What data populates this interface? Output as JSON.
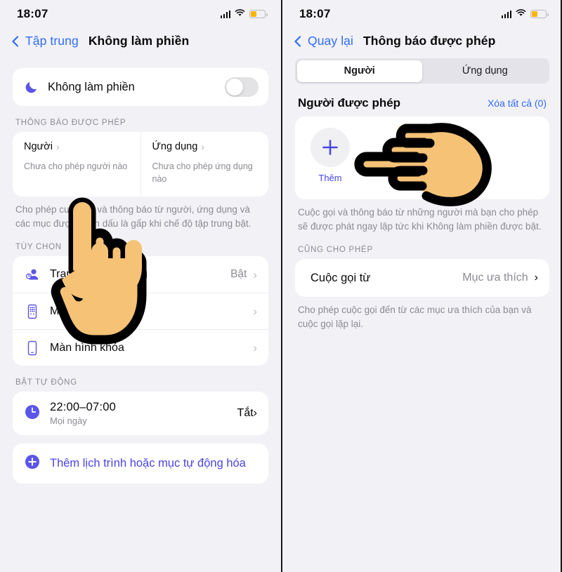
{
  "colors": {
    "accent_blue": "#2f6df6",
    "accent_purple": "#4a45e0",
    "background": "#f2f1f6",
    "card": "#ffffff",
    "muted_text": "#8b8b92",
    "battery_fill": "#f7b500"
  },
  "left_screen": {
    "status_bar": {
      "time": "18:07",
      "signal_icon": "cellular-bars-icon",
      "wifi_icon": "wifi-icon",
      "battery_icon": "battery-low-power-icon"
    },
    "nav": {
      "back_label": "Tập trung",
      "back_icon": "chevron-left-icon",
      "title": "Không làm phiền"
    },
    "dnd": {
      "icon": "moon-icon",
      "label": "Không làm phiền",
      "toggle_state": "off"
    },
    "allowed_section": {
      "header": "THÔNG BÁO ĐƯỢC PHÉP",
      "people": {
        "title": "Người",
        "chevron": "›",
        "subtitle": "Chưa cho phép người nào"
      },
      "apps": {
        "title": "Ứng dụng",
        "chevron": "›",
        "subtitle": "Chưa cho phép ứng dụng nào"
      },
      "footnote": "Cho phép cuộc gọi và thông báo từ người, ứng dụng và các mục được đánh dấu là gấp khi chế độ tập trung bật."
    },
    "options_section": {
      "header": "TÙY CHỌN",
      "rows": [
        {
          "icon": "focus-status-icon",
          "label": "Trạng thái tập trung",
          "value": "Bật",
          "chevron": "›"
        },
        {
          "icon": "home-screen-icon",
          "label": "Màn hình chính",
          "value": "",
          "chevron": "›"
        },
        {
          "icon": "lock-screen-icon",
          "label": "Màn hình khóa",
          "value": "",
          "chevron": "›"
        }
      ]
    },
    "auto_section": {
      "header": "BẬT TỰ ĐỘNG",
      "schedule": {
        "icon": "clock-icon",
        "time": "22:00–07:00",
        "repeat": "Mọi ngày",
        "value": "Tắt",
        "chevron": "›"
      },
      "add": {
        "icon": "plus-circle-icon",
        "label": "Thêm lịch trình hoặc mục tự động hóa"
      }
    },
    "cursor": {
      "icon": "pointing-up-hand-icon"
    }
  },
  "right_screen": {
    "status_bar": {
      "time": "18:07",
      "signal_icon": "cellular-bars-icon",
      "wifi_icon": "wifi-icon",
      "battery_icon": "battery-low-power-icon"
    },
    "nav": {
      "back_label": "Quay lại",
      "back_icon": "chevron-left-icon",
      "title": "Thông báo được phép"
    },
    "segmented": {
      "options": [
        "Người",
        "Ứng dụng"
      ],
      "selected": "Người"
    },
    "people_section": {
      "header": "Người được phép",
      "clear_all": "Xóa tất cả (0)",
      "add_icon": "plus-icon",
      "add_label": "Thêm",
      "footnote": "Cuộc gọi và thông báo từ những người mà bạn cho phép sẽ được phát ngay lập tức khi Không làm phiền được bật."
    },
    "also_allow_section": {
      "header": "CŨNG CHO PHÉP",
      "row": {
        "label": "Cuộc gọi từ",
        "value": "Mục ưa thích",
        "chevron": "›"
      },
      "footnote": "Cho phép cuộc gọi đến từ các mục ưa thích của bạn và cuộc gọi lặp lại."
    },
    "cursor": {
      "icon": "pointing-left-hand-icon"
    }
  }
}
